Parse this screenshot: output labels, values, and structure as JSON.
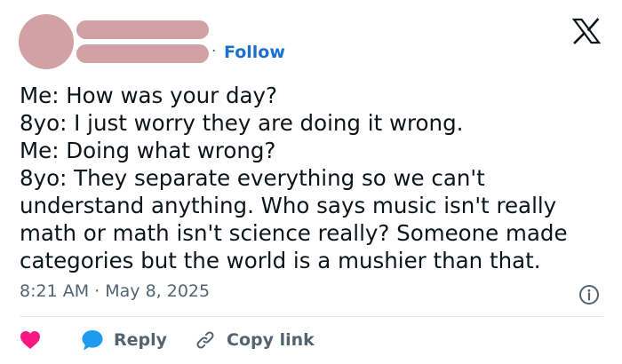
{
  "header": {
    "separator": "·",
    "follow_label": "Follow",
    "logo_icon": "x-logo-icon"
  },
  "post": {
    "lines": [
      "Me: How was your day?",
      "8yo: I just worry they are doing it wrong.",
      "Me: Doing what wrong?",
      "8yo: They separate everything so we can't",
      "understand anything. Who says music isn't really",
      "math or math isn't science really? Someone made",
      "categories but the world is a mushier than that."
    ],
    "time": "8:21 AM",
    "meta_separator": "·",
    "date": "May 8, 2025"
  },
  "actions": {
    "like_icon": "heart-icon",
    "reply_label": "Reply",
    "copy_link_label": "Copy link"
  },
  "colors": {
    "avatar_placeholder": "#d1a1a3",
    "follow": "#1d6fd1",
    "like": "#f91880",
    "reply": "#1d9bf0",
    "muted": "#536471",
    "text": "#0f1419"
  }
}
